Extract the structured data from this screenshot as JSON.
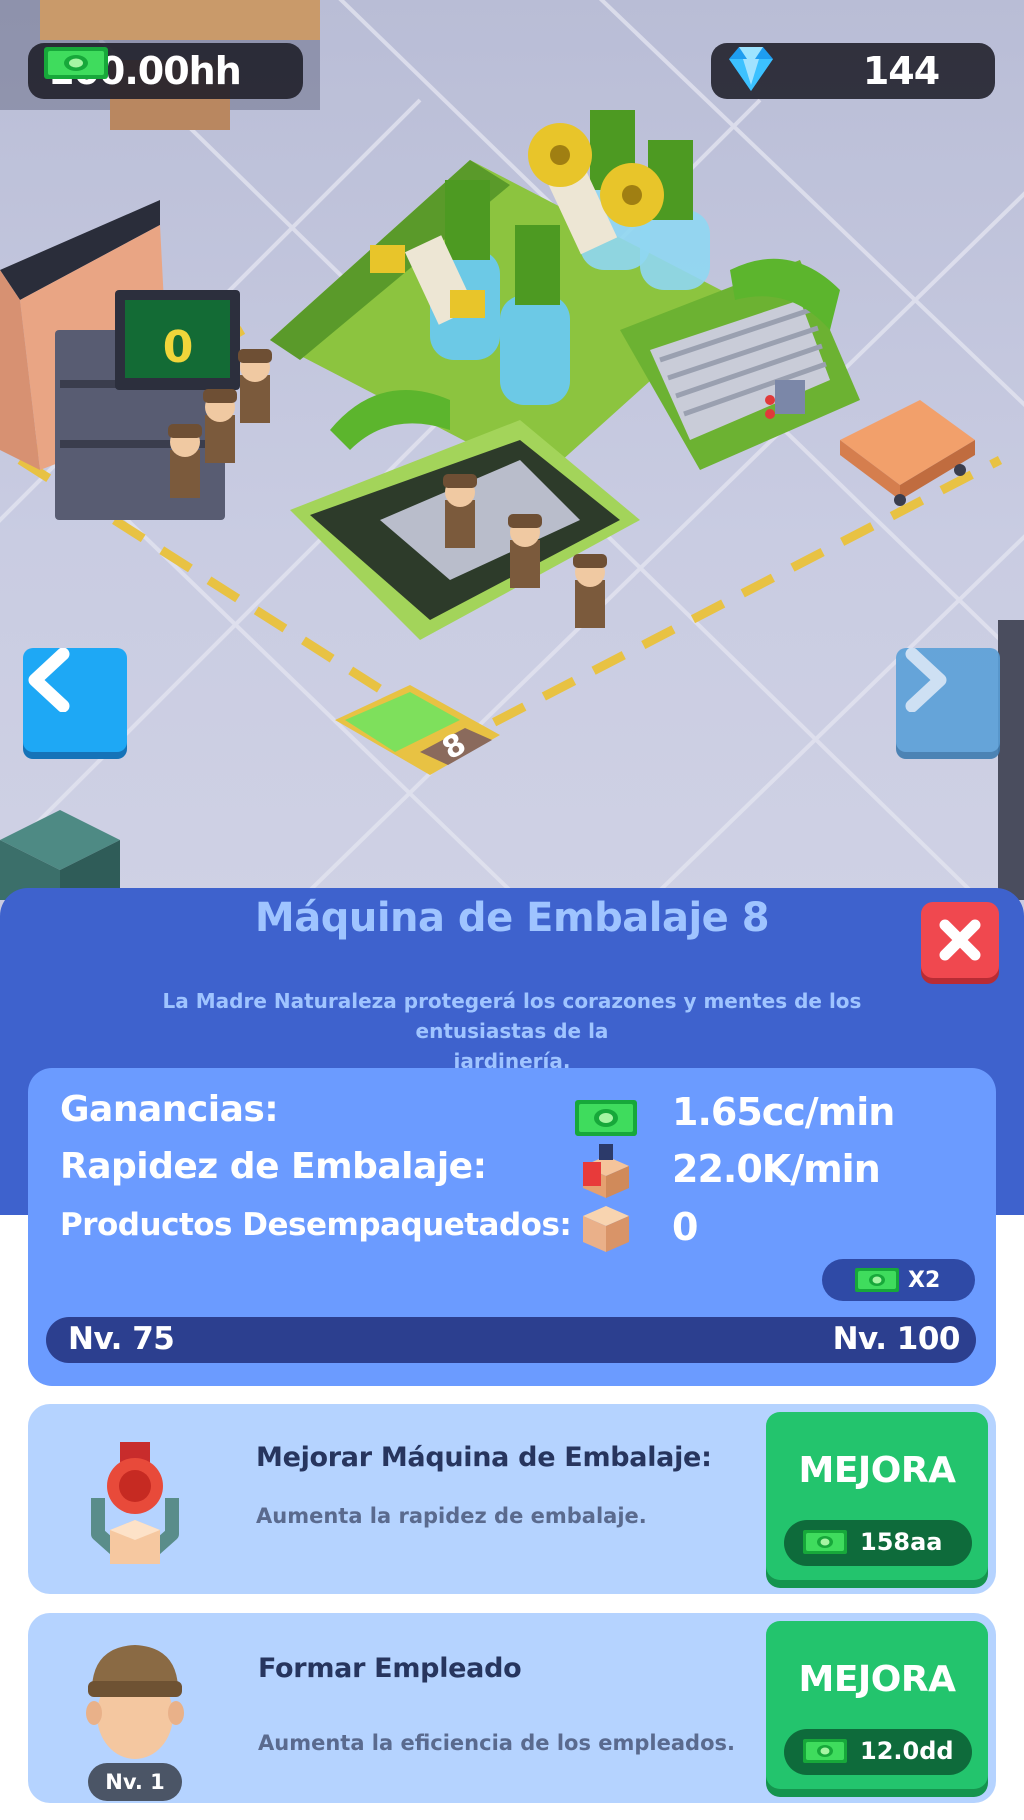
{
  "hud": {
    "money": "100.00hh",
    "gems": "144",
    "money_icon": "cash-icon",
    "gem_icon": "diamond-icon"
  },
  "scene": {
    "machine_counter": "0",
    "station_number": "8"
  },
  "navigation": {
    "prev_icon": "chevron-left-icon",
    "next_icon": "chevron-right-icon"
  },
  "panel": {
    "title": "Máquina de Embalaje 8",
    "description_line1": "La Madre Naturaleza protegerá los corazones y mentes de los entusiastas de la",
    "description_line2": "jardinería.",
    "close_icon": "close-icon",
    "stats": {
      "earnings_label": "Ganancias:",
      "earnings_value": "1.65cc/min",
      "speed_label": "Rapidez de Embalaje:",
      "speed_value": "22.0K/min",
      "unpacked_label": "Productos Desempaquetados:",
      "unpacked_value": "0",
      "multiplier": "X2",
      "level_current": "Nv. 75",
      "level_next": "Nv. 100"
    },
    "upgrades": [
      {
        "title": "Mejorar Máquina de Embalaje:",
        "description": "Aumenta la rapidez de embalaje.",
        "button_label": "MEJORA",
        "cost": "158aa",
        "icon": "packing-machine-icon"
      },
      {
        "title": "Formar Empleado",
        "description": "Aumenta la eficiencia de los empleados.",
        "button_label": "MEJORA",
        "cost": "12.0dd",
        "icon": "employee-avatar-icon",
        "level_badge": "Nv. 1"
      }
    ]
  },
  "colors": {
    "panel_bg": "#3e62cd",
    "stats_bg": "#6b9bff",
    "upgrade_card_bg": "#b5d3ff",
    "button_green": "#23c46d",
    "close_red": "#f0484f",
    "nav_blue": "#1ea8f5"
  }
}
